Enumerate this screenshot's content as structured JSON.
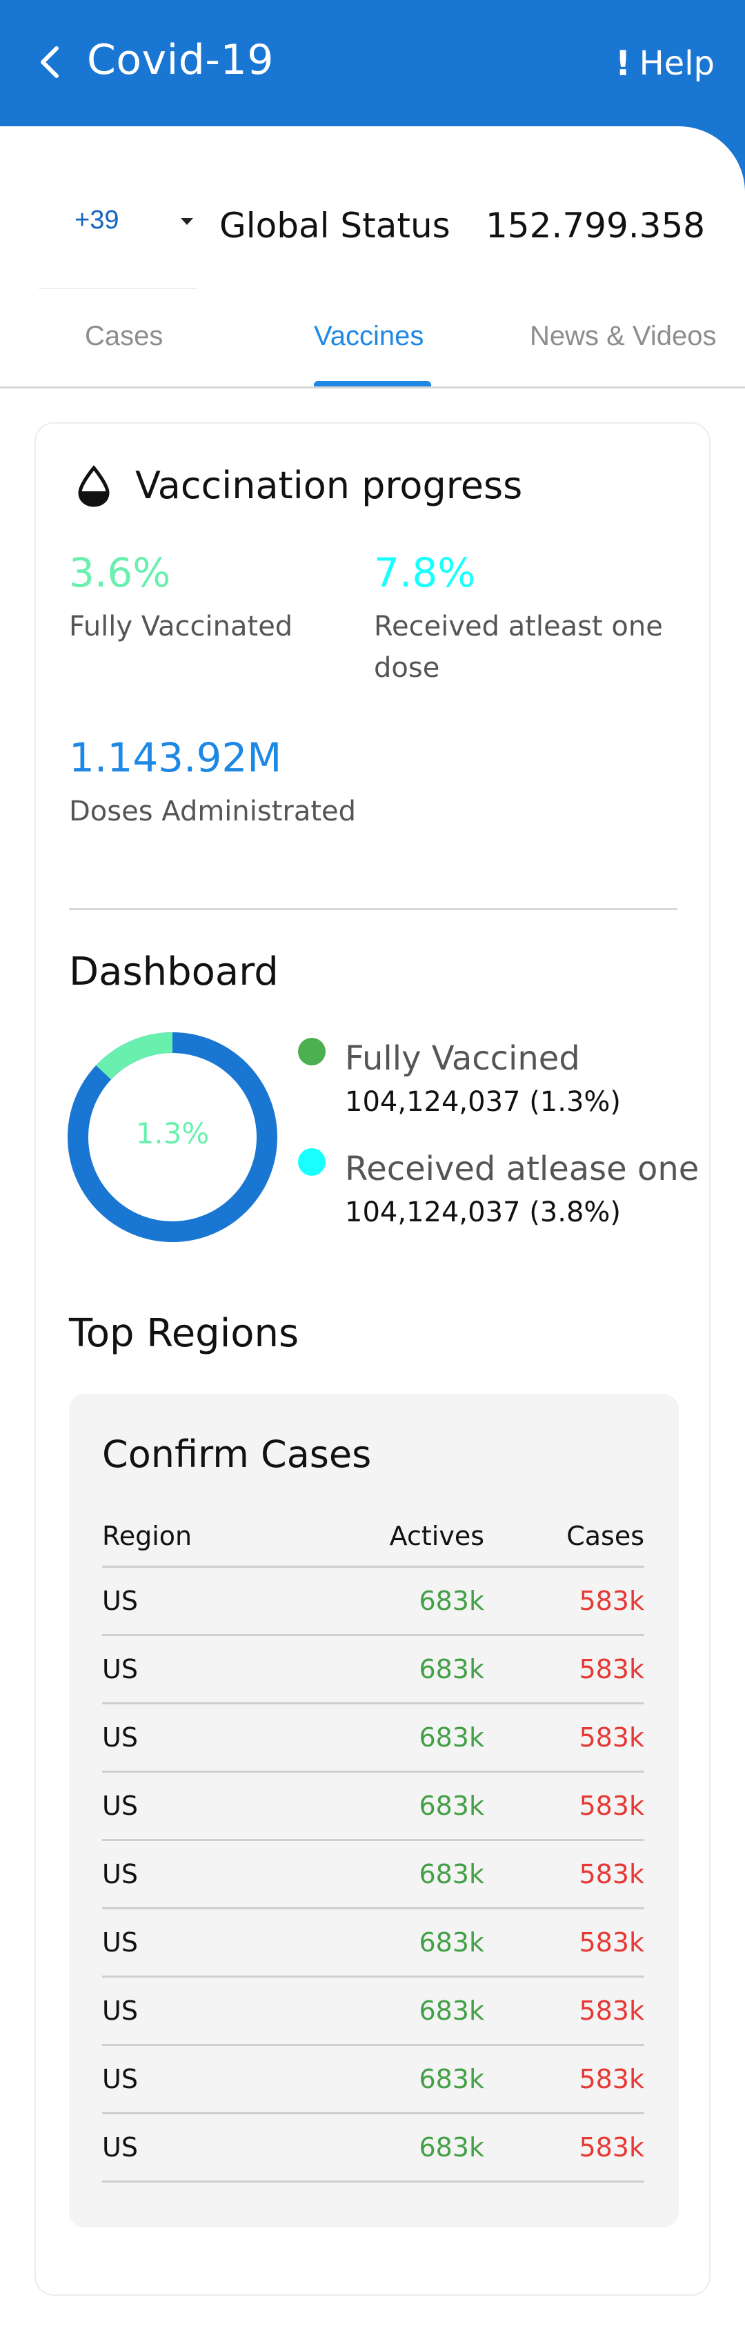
{
  "header": {
    "title": "Covid-19",
    "help_label": "Help",
    "colors": {
      "bar": "#1976d2",
      "text": "#ffffff"
    }
  },
  "status": {
    "country_code": "+39",
    "global_label": "Global Status",
    "global_value": "152.799.358"
  },
  "tabs": [
    {
      "label": "Cases",
      "active": false
    },
    {
      "label": "Vaccines",
      "active": true
    },
    {
      "label": "News & Videos",
      "active": false
    }
  ],
  "vaccination": {
    "title": "Vaccination progress",
    "fully_vaccinated": {
      "value": "3.6%",
      "label": "Fully Vaccinated",
      "color": "#69f0ae"
    },
    "one_dose": {
      "value": "7.8%",
      "label": "Received atleast one dose",
      "color": "#18ffff"
    },
    "doses": {
      "value": "1.143.92M",
      "label": "Doses Administrated",
      "color": "#1e88e5"
    }
  },
  "dashboard": {
    "title": "Dashboard",
    "donut_label": "1.3%",
    "donut_fraction": 0.13,
    "legend": [
      {
        "name": "Fully Vaccined",
        "value": "104,124,037 (1.3%)",
        "color": "#4caf50"
      },
      {
        "name": "Received atlease one",
        "value": "104,124,037 (3.8%)",
        "color": "#18ffff"
      }
    ]
  },
  "regions": {
    "title": "Top Regions",
    "box_title": "Confirm Cases",
    "columns": {
      "region": "Region",
      "actives": "Actives",
      "cases": "Cases"
    },
    "rows": [
      {
        "region": "US",
        "actives": "683k",
        "cases": "583k"
      },
      {
        "region": "US",
        "actives": "683k",
        "cases": "583k"
      },
      {
        "region": "US",
        "actives": "683k",
        "cases": "583k"
      },
      {
        "region": "US",
        "actives": "683k",
        "cases": "583k"
      },
      {
        "region": "US",
        "actives": "683k",
        "cases": "583k"
      },
      {
        "region": "US",
        "actives": "683k",
        "cases": "583k"
      },
      {
        "region": "US",
        "actives": "683k",
        "cases": "583k"
      },
      {
        "region": "US",
        "actives": "683k",
        "cases": "583k"
      },
      {
        "region": "US",
        "actives": "683k",
        "cases": "583k"
      }
    ]
  }
}
